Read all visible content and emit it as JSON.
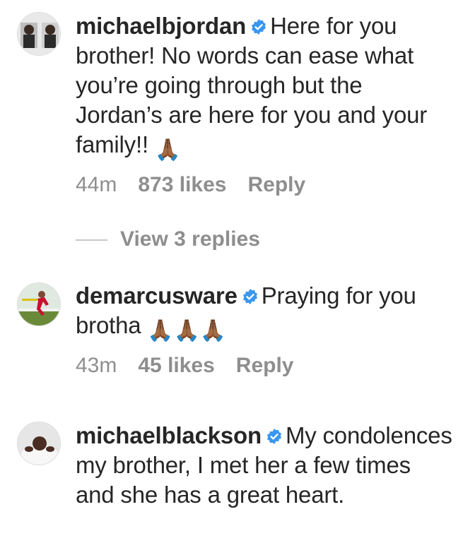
{
  "comments": [
    {
      "username": "michaelbjordan",
      "verified": true,
      "text": "Here for you brother! No words can ease what you’re going through but the Jordan’s are here for you and your family!!",
      "emoji": "🙏🏾",
      "time": "44m",
      "likes": "873 likes",
      "reply": "Reply",
      "view_replies": "View 3 replies"
    },
    {
      "username": "demarcusware",
      "verified": true,
      "text": "Praying for you brotha",
      "emoji": "🙏🏾🙏🏾🙏🏾",
      "time": "43m",
      "likes": "45 likes",
      "reply": "Reply"
    },
    {
      "username": "michaelblackson",
      "verified": true,
      "text": "My condolences my brother, I met her a few times and she has a great heart."
    }
  ],
  "colors": {
    "text": "#262626",
    "meta": "#8e8e8e",
    "verified": "#3897f0"
  },
  "icons": {
    "verified": "verified-badge-icon"
  }
}
